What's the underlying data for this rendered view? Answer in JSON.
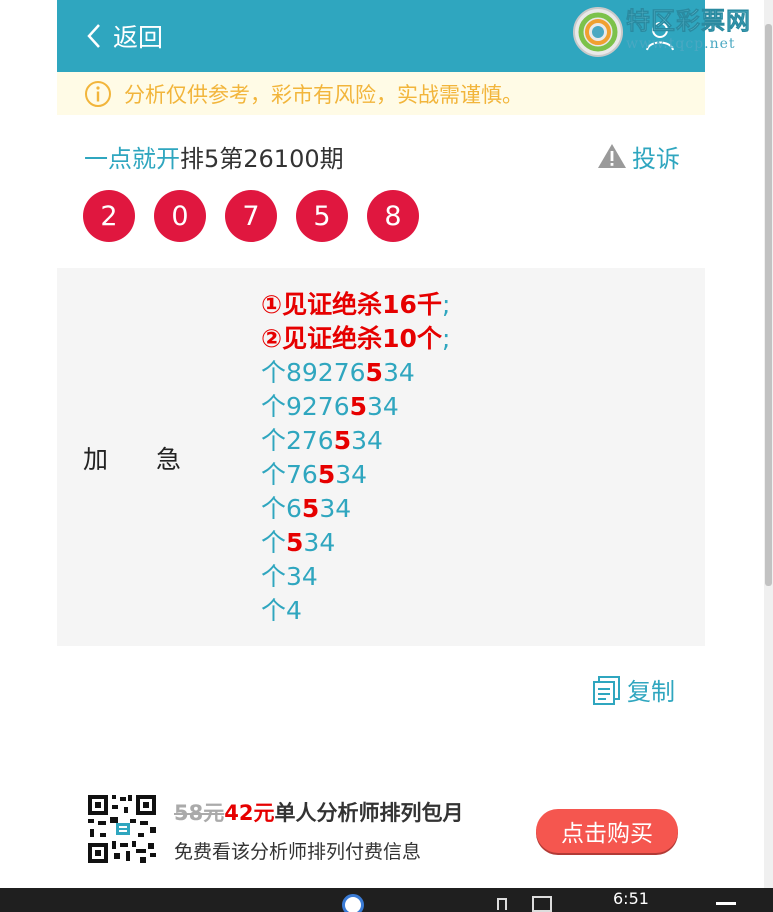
{
  "header": {
    "back_label": "返回"
  },
  "watermark": {
    "title": "特区彩票网",
    "url": "www.tqcp.net"
  },
  "notice": {
    "text": "分析仅供参考，彩市有风险，实战需谨慎。"
  },
  "issue": {
    "brand": "一点就开",
    "title": "排5第26100期",
    "complain_label": "投诉"
  },
  "balls": [
    "2",
    "0",
    "7",
    "5",
    "8"
  ],
  "content": {
    "label": "加急",
    "bold_lines": [
      {
        "text": "①见证绝杀16千",
        "semi": ";"
      },
      {
        "text": "②见证绝杀10个",
        "semi": ";"
      }
    ],
    "number_lines": [
      {
        "pre": "个89276",
        "hl": "5",
        "post": "34"
      },
      {
        "pre": "个9276",
        "hl": "5",
        "post": "34"
      },
      {
        "pre": "个276",
        "hl": "5",
        "post": "34"
      },
      {
        "pre": "个76",
        "hl": "5",
        "post": "34"
      },
      {
        "pre": "个6",
        "hl": "5",
        "post": "34"
      },
      {
        "pre": "个",
        "hl": "5",
        "post": "34"
      },
      {
        "pre": "个34",
        "hl": "",
        "post": ""
      },
      {
        "pre": "个4",
        "hl": "",
        "post": ""
      }
    ]
  },
  "copy": {
    "label": "复制"
  },
  "promo": {
    "old_price": "58元",
    "new_price": "42元",
    "title": "单人分析师排列包月",
    "subtitle": "免费看该分析师排列付费信息",
    "buy_label": "点击购买"
  },
  "taskbar": {
    "time": "6:51"
  },
  "colors": {
    "header_bg": "#2fa6bf",
    "ball_red": "#e0173f",
    "notice_bg": "#fffbe6",
    "notice_text": "#f2b53b",
    "buy_button": "#f5564f"
  }
}
